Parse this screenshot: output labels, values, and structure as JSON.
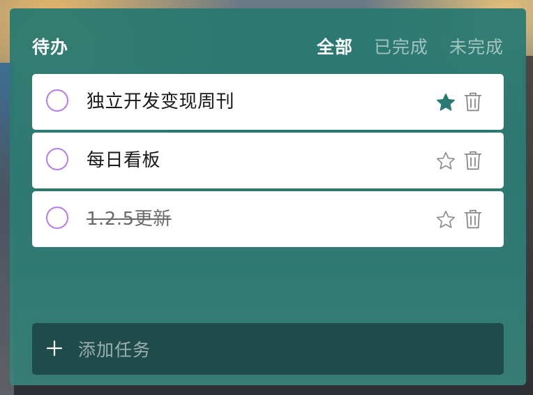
{
  "header": {
    "title": "待办",
    "filters": [
      {
        "label": "全部",
        "active": true
      },
      {
        "label": "已完成",
        "active": false
      },
      {
        "label": "未完成",
        "active": false
      }
    ]
  },
  "tasks": [
    {
      "text": "独立开发变现周刊",
      "completed": false,
      "starred": true
    },
    {
      "text": "每日看板",
      "completed": false,
      "starred": false
    },
    {
      "text": "1.2.5更新",
      "completed": true,
      "starred": false
    }
  ],
  "add_task": {
    "placeholder": "添加任务",
    "icon": "plus-icon"
  },
  "colors": {
    "panel": "#2a7a72",
    "star_active": "#2a7a72",
    "checkbox_border": "#b57cf0",
    "icon_gray": "#8a8a8a"
  },
  "icons": {
    "star_filled": "star-filled-icon",
    "star_outline": "star-outline-icon",
    "delete": "trash-icon"
  }
}
